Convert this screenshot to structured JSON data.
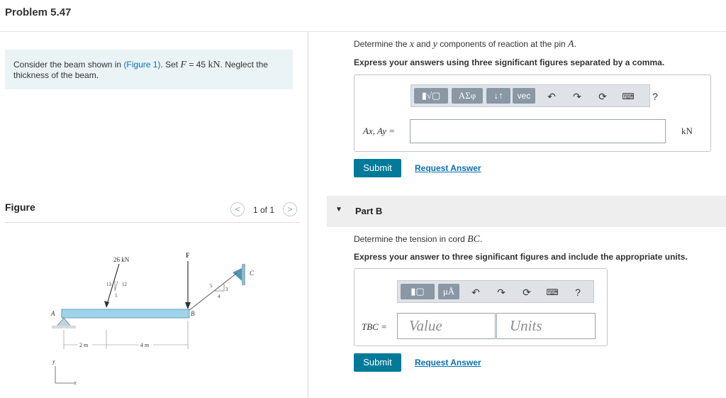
{
  "problem": {
    "title": "Problem 5.47",
    "intro": "Consider the beam shown in",
    "figure_link": "(Figure 1)",
    "set_text": ". Set",
    "var_F": "F",
    "equals_value": "= 45",
    "unit_kN": "kN",
    "neglect": ". Neglect the",
    "line2": "thickness of the beam."
  },
  "figure": {
    "heading": "Figure",
    "prev_icon": "chevron-left-icon",
    "next_icon": "chevron-right-icon",
    "prev_glyph": "<",
    "next_glyph": ">",
    "counter": "1 of 1",
    "labels": {
      "force_26": "26 kN",
      "F": "F",
      "C": "C",
      "A": "A",
      "B": "B",
      "slope_13": "13",
      "slope_12": "12",
      "slope_5a": "5",
      "cord_5": "5",
      "cord_3": "3",
      "cord_4": "4",
      "dim_2m": "2 m",
      "dim_4m": "4 m",
      "axis_y": "y",
      "axis_x": "x"
    }
  },
  "partA": {
    "question_prefix": "Determine the",
    "var_x": "x",
    "and": "and",
    "var_y": "y",
    "question_suffix": "components of reaction at the pin",
    "var_A": "A",
    "period": ".",
    "instruction": "Express your answers using three significant figures separated by a comma.",
    "toolbar": {
      "templates": "▮√▢",
      "greek": "ΑΣφ",
      "arrows": "↓↑",
      "vec": "vec",
      "undo_icon": "undo-icon",
      "redo_icon": "redo-icon",
      "reset_icon": "reset-icon",
      "keyboard_icon": "keyboard-icon",
      "help": "?"
    },
    "input_label": "Ax, Ay =",
    "unit": "kN",
    "submit": "Submit",
    "request": "Request Answer"
  },
  "partB": {
    "heading": "Part B",
    "expand_icon": "triangle-down-icon",
    "question_prefix": "Determine the tension in cord",
    "var_BC": "BC",
    "period": ".",
    "instruction": "Express your answer to three significant figures and include the appropriate units.",
    "toolbar": {
      "templates": "▮▢",
      "units": "μÅ",
      "help": "?"
    },
    "input_label": "TBC =",
    "value_placeholder": "Value",
    "units_placeholder": "Units",
    "submit": "Submit",
    "request": "Request Answer"
  },
  "colors": {
    "accent": "#007a99",
    "link": "#0a6fb3",
    "problem_bg": "#eaf4f6",
    "beam": "#9fd3ea"
  }
}
